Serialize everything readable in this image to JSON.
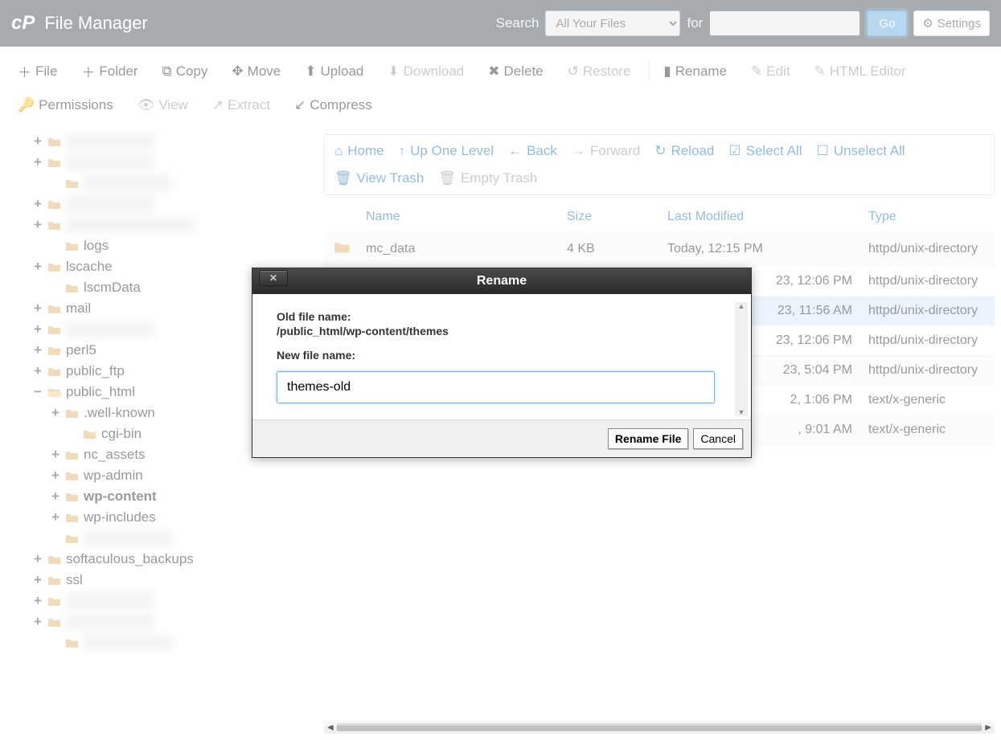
{
  "header": {
    "app_title": "File Manager",
    "search_label": "Search",
    "for_label": "for",
    "search_select": "All Your Files",
    "go_label": "Go",
    "settings_label": "Settings"
  },
  "toolbar": {
    "file": "File",
    "folder": "Folder",
    "copy": "Copy",
    "move": "Move",
    "upload": "Upload",
    "download": "Download",
    "delete": "Delete",
    "restore": "Restore",
    "rename": "Rename",
    "edit": "Edit",
    "html_editor": "HTML Editor",
    "permissions": "Permissions",
    "view": "View",
    "extract": "Extract",
    "compress": "Compress"
  },
  "content_toolbar": {
    "home": "Home",
    "up": "Up One Level",
    "back": "Back",
    "forward": "Forward",
    "reload": "Reload",
    "select_all": "Select All",
    "unselect_all": "Unselect All",
    "view_trash": "View Trash",
    "empty_trash": "Empty Trash"
  },
  "tree": [
    {
      "indent": 0,
      "toggle": "+",
      "label": "",
      "blur": true
    },
    {
      "indent": 0,
      "toggle": "+",
      "label": "",
      "blur": true
    },
    {
      "indent": 1,
      "toggle": "",
      "label": "",
      "blur": true
    },
    {
      "indent": 0,
      "toggle": "+",
      "label": "",
      "blur": true
    },
    {
      "indent": 0,
      "toggle": "+",
      "label": "",
      "blur": true,
      "wide": true
    },
    {
      "indent": 1,
      "toggle": "",
      "label": "logs"
    },
    {
      "indent": 0,
      "toggle": "+",
      "label": "lscache"
    },
    {
      "indent": 1,
      "toggle": "",
      "label": "lscmData"
    },
    {
      "indent": 0,
      "toggle": "+",
      "label": "mail"
    },
    {
      "indent": 0,
      "toggle": "+",
      "label": "",
      "blur": true
    },
    {
      "indent": 0,
      "toggle": "+",
      "label": "perl5"
    },
    {
      "indent": 0,
      "toggle": "+",
      "label": "public_ftp"
    },
    {
      "indent": 0,
      "toggle": "−",
      "label": "public_html",
      "open": true
    },
    {
      "indent": 1,
      "toggle": "+",
      "label": ".well-known"
    },
    {
      "indent": 2,
      "toggle": "",
      "label": "cgi-bin"
    },
    {
      "indent": 1,
      "toggle": "+",
      "label": "nc_assets"
    },
    {
      "indent": 1,
      "toggle": "+",
      "label": "wp-admin"
    },
    {
      "indent": 1,
      "toggle": "+",
      "label": "wp-content",
      "bold": true
    },
    {
      "indent": 1,
      "toggle": "+",
      "label": "wp-includes"
    },
    {
      "indent": 1,
      "toggle": "",
      "label": "",
      "blur": true
    },
    {
      "indent": 0,
      "toggle": "+",
      "label": "softaculous_backups"
    },
    {
      "indent": 0,
      "toggle": "+",
      "label": "ssl"
    },
    {
      "indent": 0,
      "toggle": "+",
      "label": "",
      "blur": true
    },
    {
      "indent": 0,
      "toggle": "+",
      "label": "",
      "blur": true
    },
    {
      "indent": 1,
      "toggle": "",
      "label": "",
      "blur": true
    }
  ],
  "table": {
    "headers": {
      "name": "Name",
      "size": "Size",
      "date": "Last Modified",
      "type": "Type"
    },
    "rows": [
      {
        "name": "mc_data",
        "size": "4 KB",
        "date": "Today, 12:15 PM",
        "type": "httpd/unix-directory",
        "icon": "folder"
      },
      {
        "name": "",
        "size": "",
        "date": "23, 12:06 PM",
        "type": "httpd/unix-directory",
        "icon": "",
        "partial": true
      },
      {
        "name": "",
        "size": "",
        "date": "23, 11:56 AM",
        "type": "httpd/unix-directory",
        "icon": "",
        "partial": true,
        "selected": true
      },
      {
        "name": "",
        "size": "",
        "date": "23, 12:06 PM",
        "type": "httpd/unix-directory",
        "icon": "",
        "partial": true
      },
      {
        "name": "",
        "size": "",
        "date": "23, 5:04 PM",
        "type": "httpd/unix-directory",
        "icon": "",
        "partial": true
      },
      {
        "name": "",
        "size": "",
        "date": "2, 1:06 PM",
        "type": "text/x-generic",
        "icon": "",
        "partial": true
      },
      {
        "name": "",
        "size": "",
        "date": ", 9:01 AM",
        "type": "text/x-generic",
        "icon": "",
        "partial": true
      }
    ]
  },
  "modal": {
    "title": "Rename",
    "old_label": "Old file name:",
    "old_path": "/public_html/wp-content/themes",
    "new_label": "New file name:",
    "input_value": "themes-old",
    "rename_btn": "Rename File",
    "cancel_btn": "Cancel"
  }
}
